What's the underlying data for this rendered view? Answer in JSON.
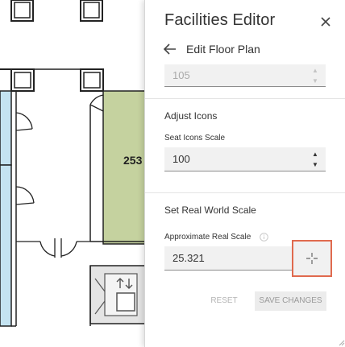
{
  "floorplan": {
    "room_label": "253",
    "colors": {
      "room_blue": "#c4e3f1",
      "room_green": "#c5d29f",
      "wall": "#222222"
    }
  },
  "panel": {
    "title": "Facilities Editor",
    "close_icon": "close-icon",
    "back_icon": "arrow-left-icon",
    "back_label": "Edit Floor Plan",
    "prev_field_value": "105",
    "adjust_icons": {
      "title": "Adjust Icons",
      "seat_scale_label": "Seat Icons Scale",
      "seat_scale_value": "100"
    },
    "real_world_scale": {
      "title": "Set Real World Scale",
      "approx_label": "Approximate Real Scale",
      "info_icon": "info-icon",
      "approx_value": "25.321",
      "crosshair_icon": "crosshair-icon",
      "highlight_color": "#e06a4e"
    },
    "actions": {
      "reset_label": "RESET",
      "save_label": "SAVE CHANGES"
    }
  }
}
